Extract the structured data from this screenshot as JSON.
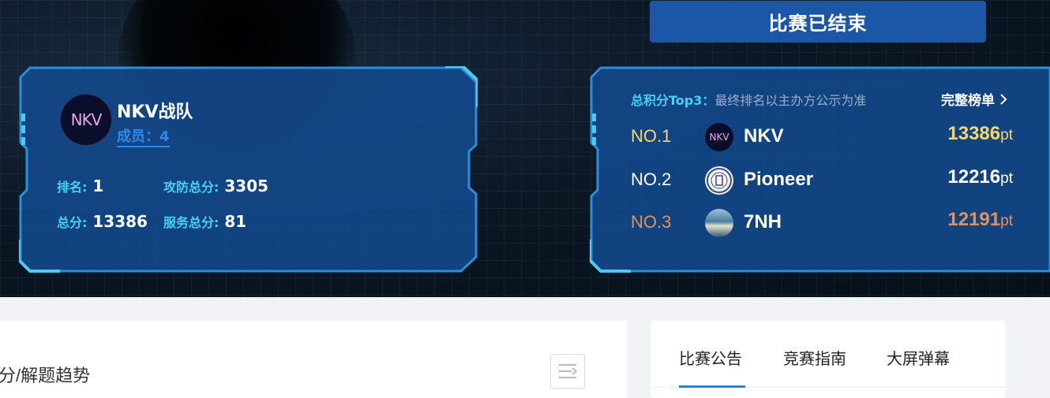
{
  "banner": {
    "status": "比赛已结束"
  },
  "team": {
    "logo_text": "NKV",
    "name": "NKV战队",
    "members": "成员：4",
    "rank_label": "排名:",
    "rank_value": "1",
    "attack_label": "攻防总分:",
    "attack_value": "3305",
    "total_label": "总分:",
    "total_value": "13386",
    "service_label": "服务总分:",
    "service_value": "81"
  },
  "top3": {
    "title_highlight": "总积分Top3：",
    "title_note": "最终排名以主办方公示为准",
    "full_link": "完整榜单",
    "rows": [
      {
        "no": "NO.1",
        "name": "NKV",
        "score": "13386",
        "unit": "pt",
        "color": "#f5d76a",
        "logo": "nkv-logo"
      },
      {
        "no": "NO.2",
        "name": "Pioneer",
        "score": "12216",
        "unit": "pt",
        "color": "#ffffff",
        "logo": "pioneer-logo"
      },
      {
        "no": "NO.3",
        "name": "7NH",
        "score": "12191",
        "unit": "pt",
        "color": "#e0925a",
        "logo": "7nh-logo"
      }
    ]
  },
  "trend": {
    "title": "分/解题趋势"
  },
  "tabs": [
    "比赛公告",
    "竞赛指南",
    "大屏弹幕"
  ]
}
